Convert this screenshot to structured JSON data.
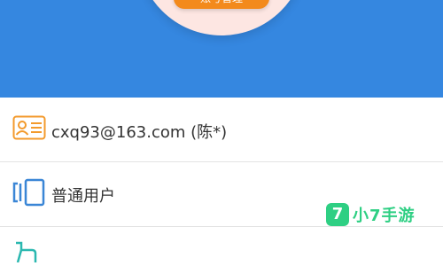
{
  "header": {
    "account_button_label": "账号管理",
    "bg_color": "#3587e0"
  },
  "list": {
    "items": [
      {
        "icon": "id-card-icon",
        "label": "cxq93@163.com (陈*)"
      },
      {
        "icon": "user-type-icon",
        "label": "普通用户"
      },
      {
        "icon": "hand-icon",
        "label": ""
      }
    ]
  },
  "watermark": {
    "logo_glyph": "7",
    "text": "小7手游",
    "color": "#2ecf83"
  }
}
